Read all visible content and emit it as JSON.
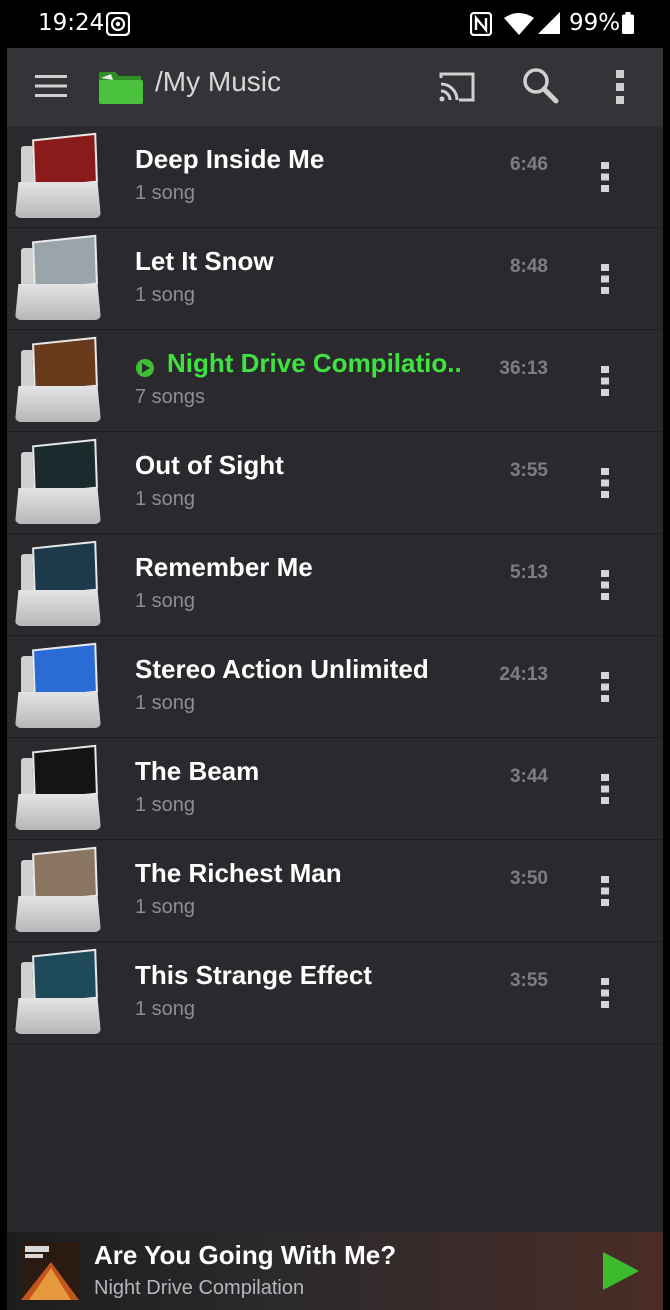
{
  "status_bar": {
    "time": "19:24",
    "battery": "99%"
  },
  "toolbar": {
    "title": "/My Music",
    "folder_icon": "green-folder-icon",
    "accent": "#3fbf33"
  },
  "list": [
    {
      "title": "Deep Inside Me",
      "sub": "1 song",
      "duration": "6:46",
      "art_color": "#8a1b1b",
      "playing": false
    },
    {
      "title": "Let It Snow",
      "sub": "1 song",
      "duration": "8:48",
      "art_color": "#9aa4ab",
      "playing": false
    },
    {
      "title": "Night Drive Compilatio..",
      "sub": "7 songs",
      "duration": "36:13",
      "art_color": "#6a3a1c",
      "playing": true
    },
    {
      "title": "Out of Sight",
      "sub": "1 song",
      "duration": "3:55",
      "art_color": "#1b2a2d",
      "playing": false
    },
    {
      "title": "Remember Me",
      "sub": "1 song",
      "duration": "5:13",
      "art_color": "#1c3a4b",
      "playing": false
    },
    {
      "title": "Stereo Action Unlimited",
      "sub": "1 song",
      "duration": "24:13",
      "art_color": "#2a6bd6",
      "playing": false
    },
    {
      "title": "The Beam",
      "sub": "1 song",
      "duration": "3:44",
      "art_color": "#141414",
      "playing": false
    },
    {
      "title": "The Richest Man",
      "sub": "1 song",
      "duration": "3:50",
      "art_color": "#8a7660",
      "playing": false
    },
    {
      "title": "This Strange Effect",
      "sub": "1 song",
      "duration": "3:55",
      "art_color": "#1f4a5a",
      "playing": false
    }
  ],
  "now_playing": {
    "title": "Are You Going With Me?",
    "artist": "Night Drive Compilation"
  },
  "colors": {
    "playing_green": "#3fe23f",
    "background": "#28282c"
  }
}
